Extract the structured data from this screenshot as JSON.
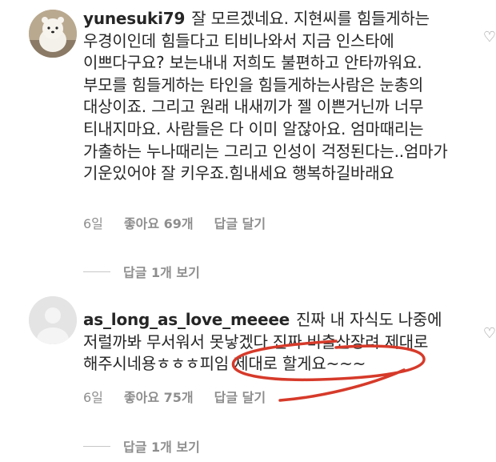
{
  "comments": [
    {
      "username": "yunesuki79",
      "text": "잘 모르겠네요. 지현씨를 힘들게하는 우경이인데 힘들다고 티비나와서 지금 인스타에 이쁘다구요? 보는내내 저희도 불편하고 안타까워요. 부모를 힘들게하는 타인을 힘들게하는사람은 눈총의 대상이죠. 그리고 원래 내새끼가 젤 이쁜거닌까 너무 티내지마요. 사람들은 다 이미 알잖아요. 엄마때리는 가출하는 누나때리는 그리고 인성이 걱정된다는..엄마가 기운있어야 잘 키우죠.힘내세요 행복하길바래요",
      "time": "6일",
      "likes": "좋아요 69개",
      "reply": "답글 달기",
      "view_replies": "답글 1개 보기"
    },
    {
      "username": "as_long_as_love_meeee",
      "text": "진짜 내 자식도 나중에 저럴까봐 무서워서 못낳겠다 진짜 비출산장려 제대로 해주시네용ㅎㅎㅎ피임 제대로 할게요~~~",
      "time": "6일",
      "likes": "좋아요 75개",
      "reply": "답글 달기",
      "view_replies": "답글 1개 보기"
    }
  ],
  "colors": {
    "annotation": "#d63a2a",
    "secondary_text": "#8e8e8e"
  },
  "icons": [
    "heart-icon",
    "avatar-default-icon"
  ]
}
